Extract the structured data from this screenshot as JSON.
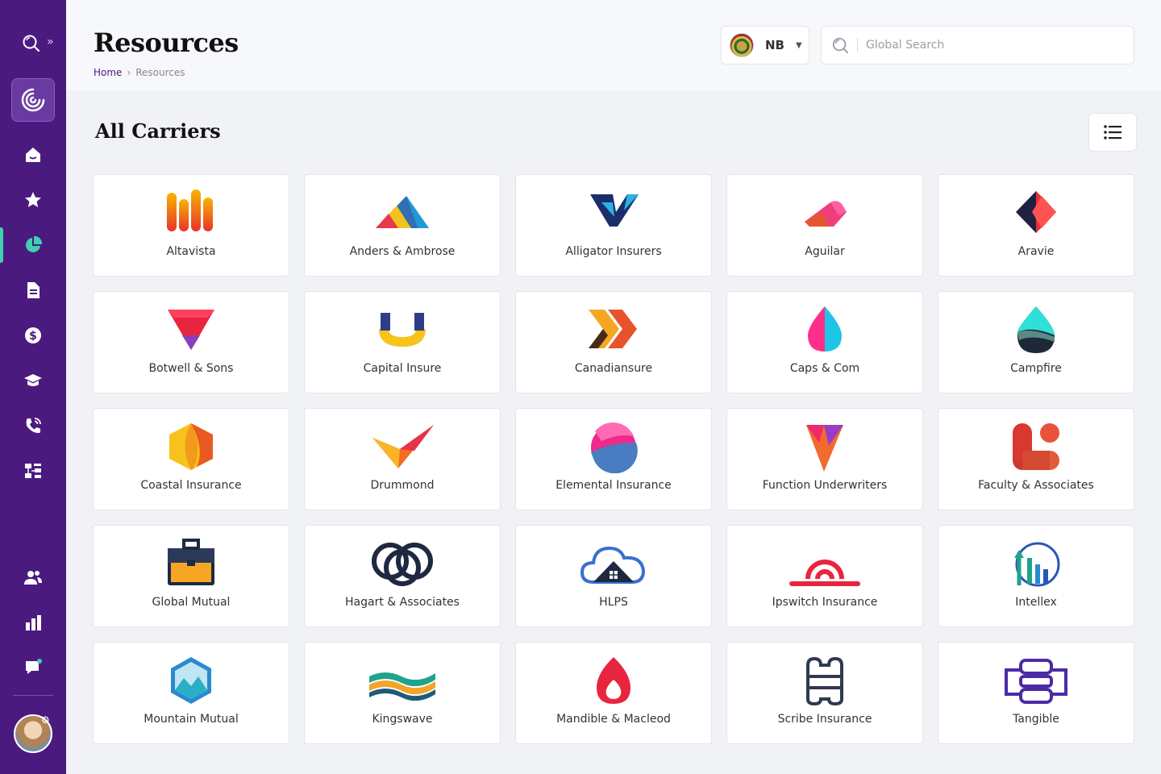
{
  "header": {
    "title": "Resources",
    "breadcrumb": {
      "home": "Home",
      "current": "Resources"
    },
    "region": {
      "code": "NB"
    },
    "search": {
      "placeholder": "Global Search"
    }
  },
  "main": {
    "section_title": "All Carriers"
  },
  "carriers": [
    {
      "name": "Altavista",
      "icon": "altavista-bars"
    },
    {
      "name": "Anders & Ambrose",
      "icon": "anders-triangles"
    },
    {
      "name": "Alligator Insurers",
      "icon": "alligator-v"
    },
    {
      "name": "Aguilar",
      "icon": "aguilar-shape"
    },
    {
      "name": "Aravie",
      "icon": "aravie-diamond"
    },
    {
      "name": "Botwell & Sons",
      "icon": "botwell-triangle"
    },
    {
      "name": "Capital Insure",
      "icon": "capital-u"
    },
    {
      "name": "Canadiansure",
      "icon": "canadiansure-chevrons"
    },
    {
      "name": "Caps & Com",
      "icon": "caps-drop"
    },
    {
      "name": "Campfire",
      "icon": "campfire-drop"
    },
    {
      "name": "Coastal Insurance",
      "icon": "coastal-hex"
    },
    {
      "name": "Drummond",
      "icon": "drummond-check"
    },
    {
      "name": "Elemental Insurance",
      "icon": "elemental-circle"
    },
    {
      "name": "Function Underwriters",
      "icon": "function-gem"
    },
    {
      "name": "Faculty & Associates",
      "icon": "faculty-blobs"
    },
    {
      "name": "Global Mutual",
      "icon": "briefcase"
    },
    {
      "name": "Hagart & Associates",
      "icon": "hagart-rings"
    },
    {
      "name": "HLPS",
      "icon": "cloud-house"
    },
    {
      "name": "Ipswitch Insurance",
      "icon": "ipswitch-arcs"
    },
    {
      "name": "Intellex",
      "icon": "intellex-circle"
    },
    {
      "name": "Mountain Mutual",
      "icon": "mountain-hex"
    },
    {
      "name": "Kingswave",
      "icon": "kingswave-waves"
    },
    {
      "name": "Mandible & Macleod",
      "icon": "mandible-flame"
    },
    {
      "name": "Scribe Insurance",
      "icon": "scribe-frame"
    },
    {
      "name": "Tangible",
      "icon": "tangible-stack"
    }
  ],
  "sidebar": {
    "items": [
      {
        "icon": "home-icon"
      },
      {
        "icon": "star-icon"
      },
      {
        "icon": "pie-chart-icon",
        "active": true
      },
      {
        "icon": "document-icon"
      },
      {
        "icon": "dollar-icon"
      },
      {
        "icon": "graduation-cap-icon"
      },
      {
        "icon": "phone-icon"
      },
      {
        "icon": "org-chart-icon"
      },
      {
        "icon": "users-icon"
      },
      {
        "icon": "bar-chart-icon"
      },
      {
        "icon": "chat-icon"
      }
    ]
  },
  "colors": {
    "sidebar": "#4b1a7f",
    "accent": "#3fd0b0",
    "brand": "#4b1a7f"
  }
}
